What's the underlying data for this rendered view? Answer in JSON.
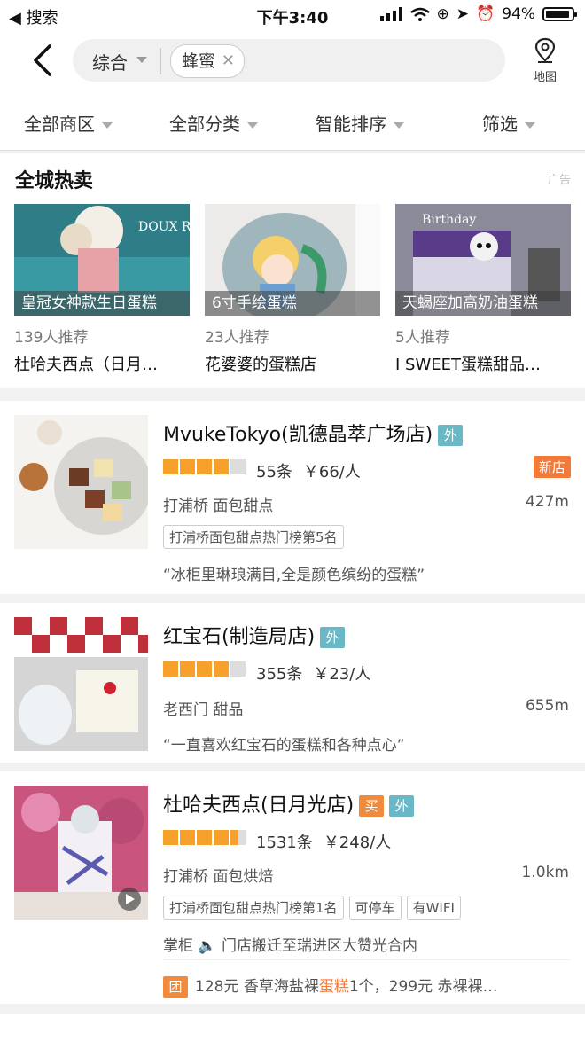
{
  "status_bar": {
    "back_label": "搜索",
    "time": "下午3:40",
    "battery": "94%"
  },
  "nav": {
    "category": "综合",
    "keyword": "蜂蜜",
    "map_label": "地图"
  },
  "filters": [
    "全部商区",
    "全部分类",
    "智能排序",
    "筛选"
  ],
  "hot": {
    "title": "全城热卖",
    "ad_label": "广告",
    "cards": [
      {
        "caption": "皇冠女神款生日蛋糕",
        "recommend": "139人推荐",
        "shop": "杜哈夫西点（日月…"
      },
      {
        "caption": "6寸手绘蛋糕",
        "recommend": "23人推荐",
        "shop": "花婆婆的蛋糕店"
      },
      {
        "caption": "天蝎座加高奶油蛋糕",
        "recommend": "5人推荐",
        "shop": "I SWEET蛋糕甜品…"
      }
    ]
  },
  "shops": [
    {
      "name": "MvukeTokyo(凯德晶萃广场店)",
      "tags": [
        "外"
      ],
      "rating": 4,
      "reviews": "55条",
      "price": "￥66/人",
      "badge": "新店",
      "area": "打浦桥  面包甜点",
      "distance": "427m",
      "ranks": [
        "打浦桥面包甜点热门榜第5名"
      ],
      "quote": "“冰柜里琳琅满目,全是颜色缤纷的蛋糕”"
    },
    {
      "name": "红宝石(制造局店)",
      "tags": [
        "外"
      ],
      "rating": 4,
      "reviews": "355条",
      "price": "￥23/人",
      "area": "老西门  甜品",
      "distance": "655m",
      "quote": "“一直喜欢红宝石的蛋糕和各种点心”"
    },
    {
      "name": "杜哈夫西点(日月光店)",
      "tags": [
        "买",
        "外"
      ],
      "rating": 4.5,
      "reviews": "1531条",
      "price": "￥248/人",
      "area": "打浦桥  面包烘焙",
      "distance": "1.0km",
      "ranks": [
        "打浦桥面包甜点热门榜第1名",
        "可停车",
        "有WIFI"
      ],
      "notice_prefix": "掌柜",
      "notice": "门店搬迁至瑞进区大赞光合内",
      "deal_tag": "团",
      "deal_pre": "128元 香草海盐裸",
      "deal_hl": "蛋糕",
      "deal_post": "1个，299元 赤裸裸…"
    }
  ],
  "colors": {
    "accent": "#f47a3a",
    "star": "#f5a12c",
    "wai_tag": "#6ab8c6"
  }
}
